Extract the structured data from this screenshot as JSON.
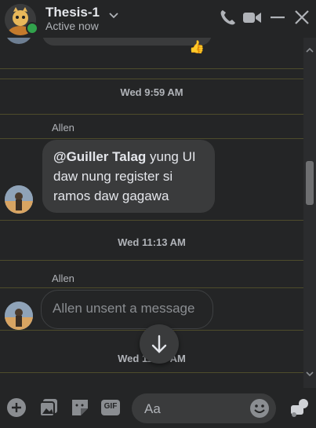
{
  "header": {
    "title": "Thesis-1",
    "status": "Active now"
  },
  "messages": {
    "time_1": "Wed 9:59 AM",
    "sender_1": "Allen",
    "mention": "@Guiller Talag",
    "message_1_line_1": " yung UI",
    "message_1_line_2": "daw nung register si",
    "message_1_line_3": "ramos daw gagawa",
    "time_2": "Wed 11:13 AM",
    "sender_2": "Allen",
    "unsent_text": "Allen unsent a message",
    "time_3": "Wed 11:13 AM",
    "reaction_emoji": "👍"
  },
  "composer": {
    "placeholder": "Aa",
    "gif_label": "GIF"
  },
  "colors": {
    "background": "#242526",
    "bubble": "#3a3b3c",
    "online": "#31a24c",
    "divider": "#5c5a2e"
  }
}
